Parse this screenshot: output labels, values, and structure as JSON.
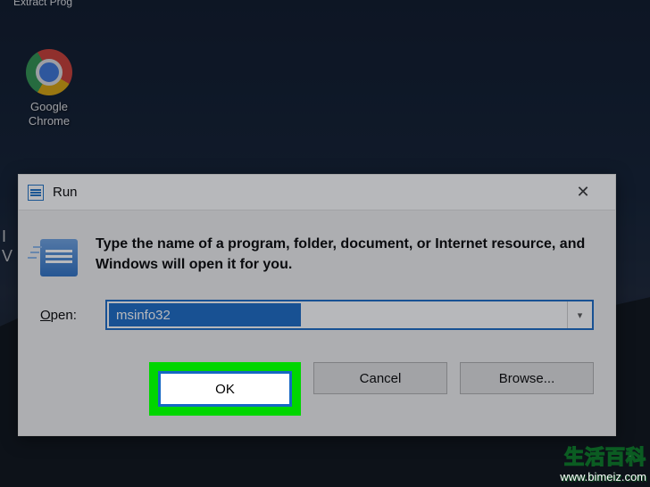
{
  "desktop": {
    "cut_icon_label": "Extract Prog",
    "chrome_label": "Google\nChrome",
    "edge_text_line1": "I",
    "edge_text_line2": "V"
  },
  "run_dialog": {
    "title": "Run",
    "instruction": "Type the name of a program, folder, document, or Internet resource, and Windows will open it for you.",
    "open_label": "Open:",
    "open_value": "msinfo32",
    "buttons": {
      "ok": "OK",
      "cancel": "Cancel",
      "browse": "Browse..."
    }
  },
  "watermark": {
    "line1": "生活百科",
    "line2": "www.bimeiz.com"
  }
}
